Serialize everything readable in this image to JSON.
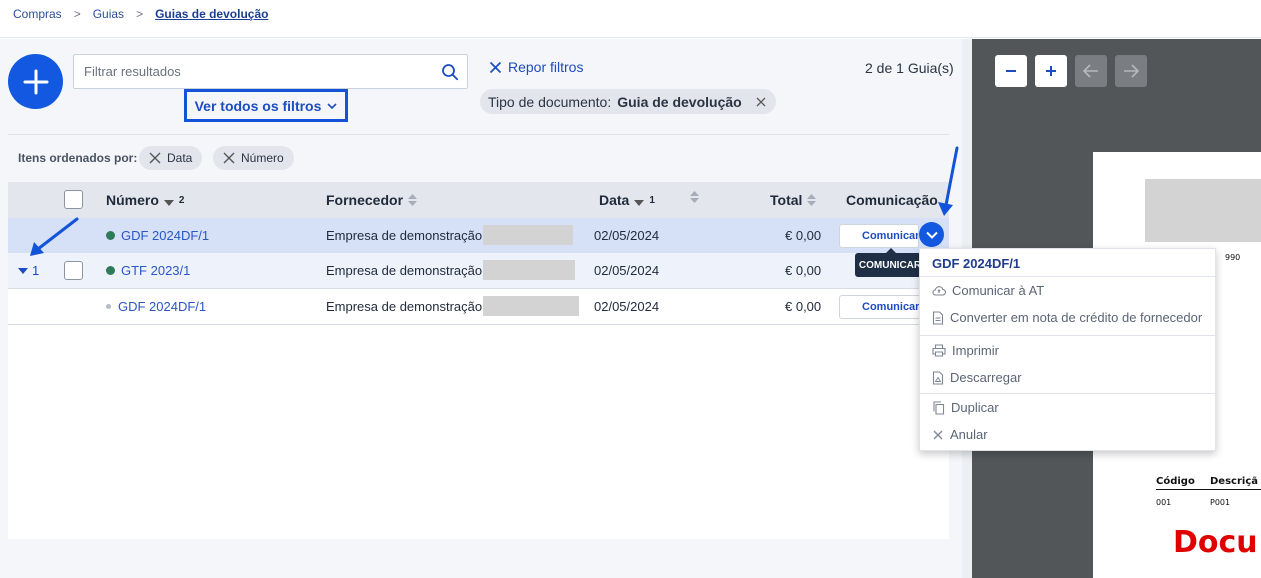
{
  "breadcrumb": {
    "items": [
      "Compras",
      "Guias",
      "Guias de devolução"
    ]
  },
  "search": {
    "placeholder": "Filtrar resultados"
  },
  "filters": {
    "see_all_label": "Ver todos os filtros",
    "reset_label": "Repor filtros",
    "count_label": "2 de 1 Guia(s)",
    "active_chip": {
      "key": "Tipo de documento:",
      "value": "Guia de devolução"
    }
  },
  "sort": {
    "label": "Itens ordenados por:",
    "chips": [
      "Data",
      "Número"
    ]
  },
  "table": {
    "columns": {
      "number": "Número",
      "number_sort_index": "2",
      "supplier": "Fornecedor",
      "date": "Data",
      "date_sort_index": "1",
      "total": "Total",
      "communication": "Comunicação"
    },
    "rows": [
      {
        "number": "GDF 2024DF/1",
        "supplier": "Empresa de demonstração",
        "date": "02/05/2024",
        "total": "€ 0,00",
        "action": "Comunicar",
        "status": "green"
      },
      {
        "number": "GTF 2023/1",
        "supplier": "Empresa de demonstração",
        "date": "02/05/2024",
        "total": "€ 0,00",
        "group_count": "1",
        "status": "green"
      },
      {
        "number": "GDF 2024DF/1",
        "supplier": "Empresa de demonstração",
        "date": "02/05/2024",
        "total": "€ 0,00",
        "action": "Comunicar",
        "status": "gray"
      }
    ]
  },
  "tooltip": "COMUNICAR",
  "menu": {
    "title": "GDF 2024DF/1",
    "items": [
      "Comunicar à AT",
      "Converter em nota de crédito de fornecedor",
      "Imprimir",
      "Descarregar",
      "Duplicar",
      "Anular"
    ]
  },
  "preview": {
    "page_code_fragment": "990",
    "table_headers": [
      "Código",
      "Descriçã"
    ],
    "table_values": [
      "001",
      "P001"
    ],
    "doc_title_fragment": "Docu"
  },
  "colors": {
    "primary": "#1358e0",
    "link": "#2a55c4",
    "status_green": "#2f7a5a",
    "preview_bg": "#525659",
    "doc_red": "#e00000"
  }
}
